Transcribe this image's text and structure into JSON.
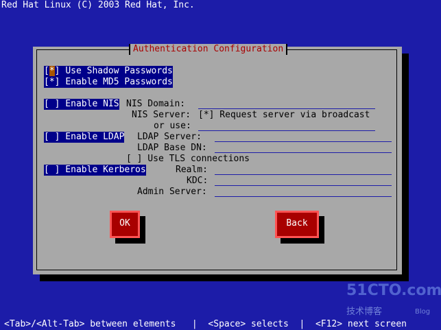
{
  "header": {
    "text": "Red Hat Linux (C) 2003 Red Hat, Inc."
  },
  "dialog": {
    "title": "Authentication Configuration",
    "shadow_passwords": {
      "mark": "*",
      "label": "Use Shadow Passwords"
    },
    "md5_passwords": {
      "mark": "[*]",
      "label": "Enable MD5 Passwords"
    },
    "nis": {
      "checkbox": "[ ] Enable NIS",
      "domain_label": "NIS Domain:",
      "server_label": "NIS Server:",
      "broadcast": "[*] Request server via broadcast",
      "or_use": "or use:"
    },
    "ldap": {
      "checkbox": "[ ] Enable LDAP",
      "server_label": "LDAP Server:",
      "basedn_label": "LDAP Base DN:",
      "tls": "[ ] Use TLS connections"
    },
    "kerberos": {
      "checkbox": "[ ] Enable Kerberos",
      "realm_label": "Realm:",
      "kdc_label": "KDC:",
      "admin_label": "Admin Server:"
    },
    "ok_label": "OK",
    "back_label": "Back"
  },
  "statusbar": {
    "text": "<Tab>/<Alt-Tab> between elements   |  <Space> selects  |  <F12> next screen"
  },
  "watermark": {
    "logo": "51CTO.com",
    "sub": "技术博客",
    "blog": "Blog"
  },
  "colors": {
    "screen_bg": "#1c1ca8",
    "dialog_bg": "#a8a8a8",
    "title": "#a80000",
    "highlight": "#00008a",
    "button": "#a80000"
  }
}
